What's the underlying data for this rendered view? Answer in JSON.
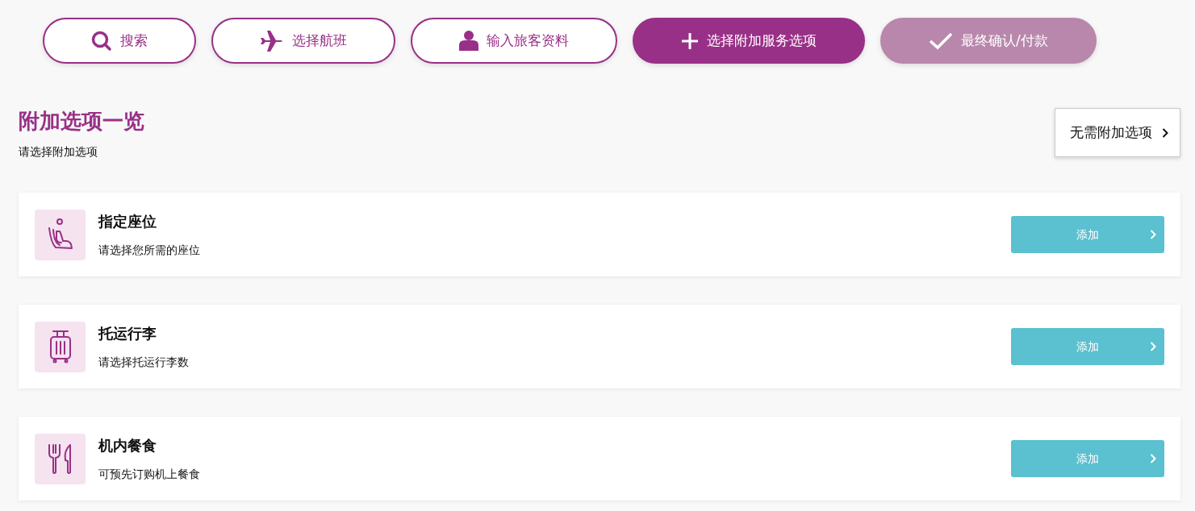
{
  "steps": [
    {
      "label": "搜索",
      "kind": "search",
      "selected": false,
      "disabled": false
    },
    {
      "label": "选择航班",
      "kind": "plane",
      "selected": false,
      "disabled": false
    },
    {
      "label": "输入旅客资料",
      "kind": "person",
      "selected": false,
      "disabled": false
    },
    {
      "label": "选择附加服务选项",
      "kind": "plus",
      "selected": true,
      "disabled": false
    },
    {
      "label": "最终确认/付款",
      "kind": "check",
      "selected": false,
      "disabled": true
    }
  ],
  "heading": "附加选项一览",
  "subtitle": "请选择附加选项",
  "skip_button": "无需附加选项",
  "options": [
    {
      "kind": "seat",
      "title": "指定座位",
      "description": "请选择您所需的座位",
      "button": "添加"
    },
    {
      "kind": "luggage",
      "title": "托运行李",
      "description": "请选择托运行李数",
      "button": "添加"
    },
    {
      "kind": "meal",
      "title": "机内餐食",
      "description": "可预先订购机上餐食",
      "button": "添加"
    }
  ]
}
